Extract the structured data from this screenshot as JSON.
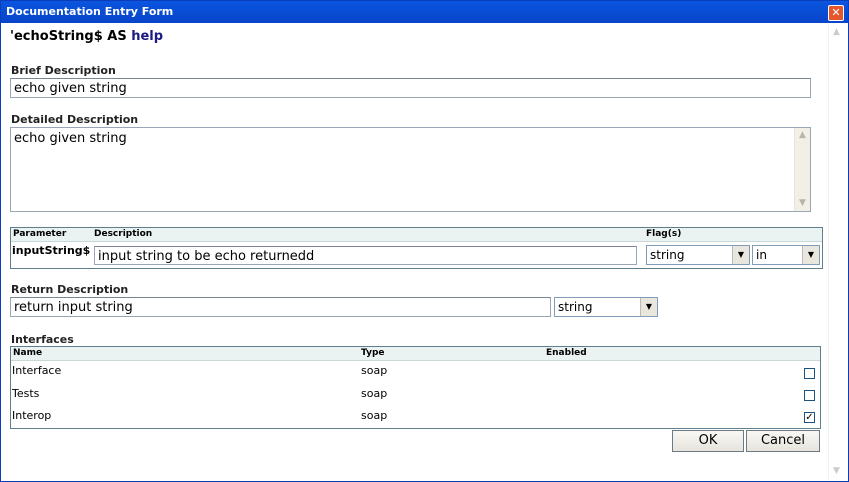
{
  "window": {
    "title": "Documentation Entry Form",
    "close_symbol": "✕"
  },
  "header": {
    "title_prefix": "'echoString$ AS ",
    "title_type": "help"
  },
  "brief": {
    "label": "Brief Description",
    "value": "echo given string"
  },
  "detailed": {
    "label": "Detailed Description",
    "value": "echo given string"
  },
  "parameters": {
    "headers": {
      "parameter": "Parameter",
      "description": "Description",
      "flags": "Flag(s)"
    },
    "rows": [
      {
        "name": "inputString$",
        "description": "input string to be echo returnedd",
        "type": "string",
        "direction": "in"
      }
    ]
  },
  "return": {
    "label": "Return Description",
    "value": "return input string",
    "type": "string"
  },
  "interfaces": {
    "label": "Interfaces",
    "headers": {
      "name": "Name",
      "type": "Type",
      "enabled": "Enabled"
    },
    "rows": [
      {
        "name": "Interface",
        "type": "soap",
        "enabled": false
      },
      {
        "name": "Tests",
        "type": "soap",
        "enabled": false
      },
      {
        "name": "Interop",
        "type": "soap",
        "enabled": true
      }
    ]
  },
  "buttons": {
    "ok": "OK",
    "cancel": "Cancel"
  },
  "icons": {
    "scroll_up": "▲",
    "scroll_down": "▼",
    "dropdown": "▼",
    "check": "✓"
  }
}
